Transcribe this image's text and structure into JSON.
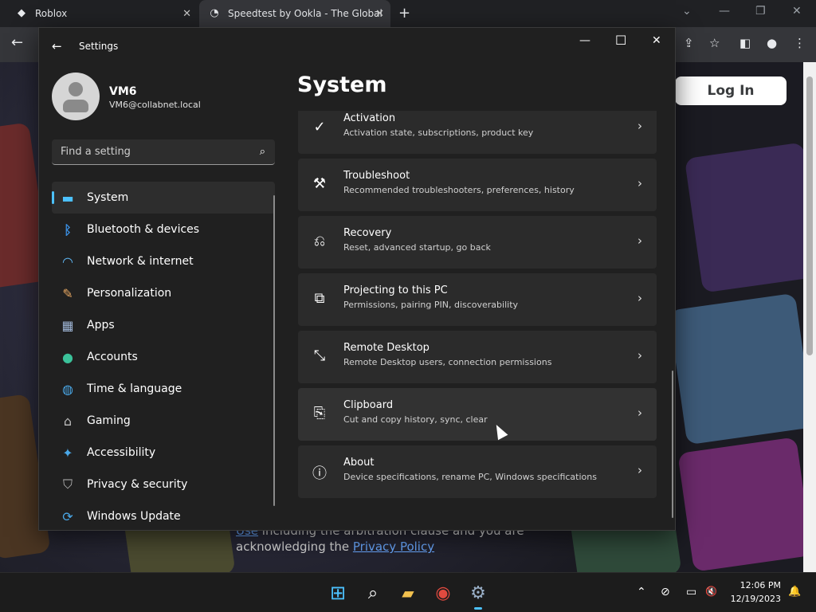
{
  "browser": {
    "tabs": [
      {
        "title": "Roblox",
        "favicon": "roblox-icon"
      },
      {
        "title": "Speedtest by Ookla - The Global",
        "favicon": "speedtest-icon"
      }
    ],
    "tab_close_glyph": "✕",
    "new_tab_glyph": "+",
    "toolbar_glyphs": {
      "back": "←",
      "share": "⇪",
      "star": "☆",
      "sidepanel": "◧",
      "profile": "●",
      "menu": "⋮"
    },
    "window_glyphs": {
      "dropdown": "⌄",
      "minimize": "—",
      "restore": "❐",
      "close": "✕"
    }
  },
  "webpage": {
    "login_label": "Log In",
    "terms_line_1_link": "Use",
    "terms_line_1_rest": " including the arbitration clause and you are",
    "terms_line_2_text": "acknowledging the ",
    "terms_line_2_link": "Privacy Policy"
  },
  "settings": {
    "window_title": "Settings",
    "back_glyph": "←",
    "window_glyphs": {
      "minimize": "—",
      "maximize": "☐",
      "close": "✕"
    },
    "profile": {
      "name": "VM6",
      "email": "VM6@collabnet.local"
    },
    "search": {
      "placeholder": "Find a setting",
      "glyph": "⌕"
    },
    "nav": [
      {
        "label": "System",
        "icon": "system-icon",
        "glyph": "▬",
        "color": "#4cc2ff"
      },
      {
        "label": "Bluetooth & devices",
        "icon": "bluetooth-icon",
        "glyph": "ᛒ",
        "color": "#3a8dde"
      },
      {
        "label": "Network & internet",
        "icon": "wifi-icon",
        "glyph": "◠",
        "color": "#5fb8f5"
      },
      {
        "label": "Personalization",
        "icon": "brush-icon",
        "glyph": "✎",
        "color": "#e8a862"
      },
      {
        "label": "Apps",
        "icon": "apps-icon",
        "glyph": "▦",
        "color": "#9fb6d6"
      },
      {
        "label": "Accounts",
        "icon": "person-icon",
        "glyph": "●",
        "color": "#3bc29a"
      },
      {
        "label": "Time & language",
        "icon": "globe-icon",
        "glyph": "◍",
        "color": "#4aa8e8"
      },
      {
        "label": "Gaming",
        "icon": "gamepad-icon",
        "glyph": "⌂",
        "color": "#bdbdbd"
      },
      {
        "label": "Accessibility",
        "icon": "accessibility-icon",
        "glyph": "✦",
        "color": "#4aa8e8"
      },
      {
        "label": "Privacy & security",
        "icon": "shield-icon",
        "glyph": "⛉",
        "color": "#b8b8b8"
      },
      {
        "label": "Windows Update",
        "icon": "update-icon",
        "glyph": "⟳",
        "color": "#4aa8e8"
      }
    ],
    "main": {
      "title": "System",
      "cards": [
        {
          "title": "Activation",
          "subtitle": "Activation state, subscriptions, product key",
          "icon": "check-circle-icon",
          "glyph": "✓"
        },
        {
          "title": "Troubleshoot",
          "subtitle": "Recommended troubleshooters, preferences, history",
          "icon": "wrench-icon",
          "glyph": "⚒"
        },
        {
          "title": "Recovery",
          "subtitle": "Reset, advanced startup, go back",
          "icon": "recovery-icon",
          "glyph": "⎌"
        },
        {
          "title": "Projecting to this PC",
          "subtitle": "Permissions, pairing PIN, discoverability",
          "icon": "projector-icon",
          "glyph": "⧉"
        },
        {
          "title": "Remote Desktop",
          "subtitle": "Remote Desktop users, connection permissions",
          "icon": "remote-desktop-icon",
          "glyph": "⤡"
        },
        {
          "title": "Clipboard",
          "subtitle": "Cut and copy history, sync, clear",
          "icon": "clipboard-icon",
          "glyph": "⎘"
        },
        {
          "title": "About",
          "subtitle": "Device specifications, rename PC, Windows specifications",
          "icon": "info-icon",
          "glyph": "ⓘ"
        }
      ],
      "chevron_glyph": "›"
    }
  },
  "taskbar": {
    "apps": [
      {
        "icon": "windows-start-icon",
        "glyph": "⊞",
        "color": "#4cc2ff"
      },
      {
        "icon": "search-icon",
        "glyph": "⌕",
        "color": "#ffffff"
      },
      {
        "icon": "file-explorer-icon",
        "glyph": "▰",
        "color": "#f2c14e"
      },
      {
        "icon": "chrome-icon",
        "glyph": "◉",
        "color": "#e04a3f"
      },
      {
        "icon": "settings-icon",
        "glyph": "⚙",
        "color": "#9ab0c8"
      }
    ],
    "tray_glyphs": {
      "chevron": "⌃",
      "network": "⊘",
      "display": "▭",
      "volume": "🔇",
      "notifications": "🔔"
    },
    "time": "12:06 PM",
    "date": "12/19/2023"
  }
}
